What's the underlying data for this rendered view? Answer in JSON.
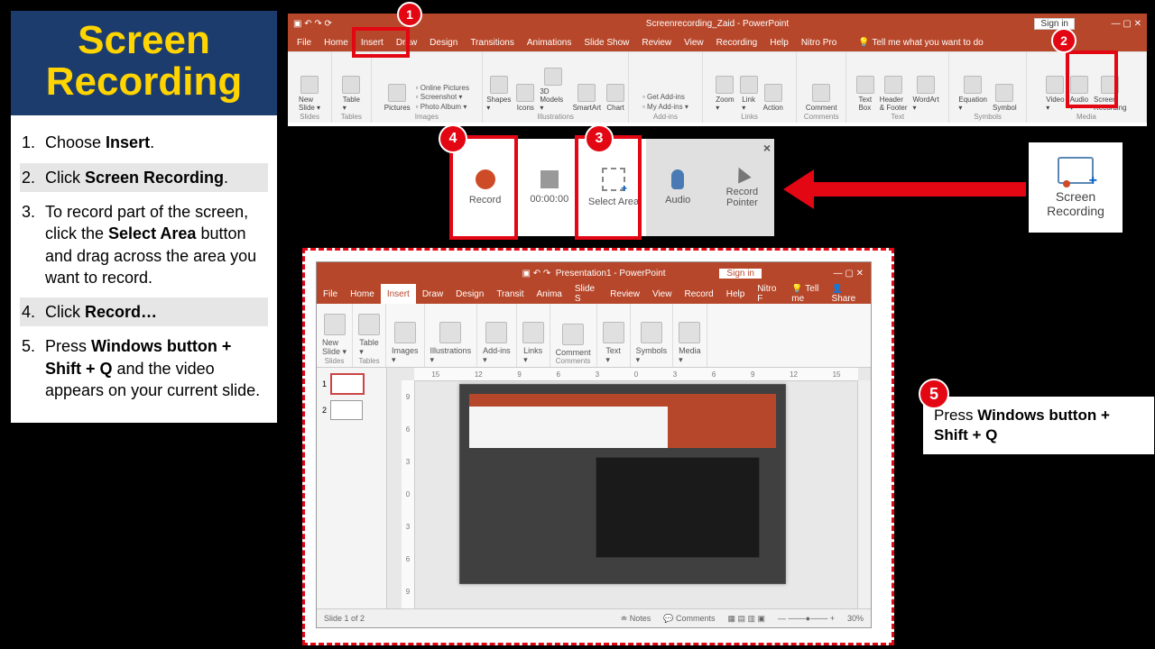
{
  "title_line1": "Screen",
  "title_line2": "Recording",
  "steps": [
    {
      "num": "1.",
      "pre": "Choose ",
      "bold": "Insert",
      "post": "."
    },
    {
      "num": "2.",
      "pre": "Click ",
      "bold": "Screen Recording",
      "post": ".",
      "active": true
    },
    {
      "num": "3.",
      "pre": "To record part of the screen, click the ",
      "bold": "Select Area",
      "post": " button and drag across the area you want to record."
    },
    {
      "num": "4.",
      "pre": "Click ",
      "bold": "Record…",
      "post": "",
      "active": true
    },
    {
      "num": "5.",
      "pre": "Press ",
      "bold": "Windows button + Shift + Q",
      "post": " and the video appears on your current slide."
    }
  ],
  "markers": {
    "m1": "1",
    "m2": "2",
    "m3": "3",
    "m4": "4",
    "m5": "5"
  },
  "ribbon": {
    "titlebar_doc": "Screenrecording_Zaid - PowerPoint",
    "signin": "Sign in",
    "tabs": [
      "File",
      "Home",
      "Insert",
      "Draw",
      "Design",
      "Transitions",
      "Animations",
      "Slide Show",
      "Review",
      "View",
      "Recording",
      "Help",
      "Nitro Pro"
    ],
    "tellme": "Tell me what you want to do",
    "groups": {
      "slides": {
        "label": "Slides",
        "items": [
          "New Slide ▾"
        ]
      },
      "tables": {
        "label": "Tables",
        "items": [
          "Table ▾"
        ]
      },
      "images": {
        "label": "Images",
        "items": [
          "Pictures"
        ],
        "mini": [
          "Online Pictures",
          "Screenshot ▾",
          "Photo Album ▾"
        ]
      },
      "illus": {
        "label": "Illustrations",
        "items": [
          "Shapes ▾",
          "Icons",
          "3D Models ▾",
          "SmartArt",
          "Chart"
        ]
      },
      "addins": {
        "label": "Add-ins",
        "mini": [
          "Get Add-ins",
          "My Add-ins ▾"
        ]
      },
      "links": {
        "label": "Links",
        "items": [
          "Zoom ▾",
          "Link ▾",
          "Action"
        ]
      },
      "comments": {
        "label": "Comments",
        "items": [
          "Comment"
        ]
      },
      "text": {
        "label": "Text",
        "items": [
          "Text Box",
          "Header & Footer",
          "WordArt ▾"
        ]
      },
      "symbols": {
        "label": "Symbols",
        "items": [
          "Equation ▾",
          "Symbol"
        ]
      },
      "media": {
        "label": "Media",
        "items": [
          "Video ▾",
          "Audio ▾",
          "Screen Recording"
        ]
      }
    }
  },
  "toolbar": {
    "record": "Record",
    "time": "00:00:00",
    "select": "Select Area",
    "audio": "Audio",
    "pointer": "Record Pointer",
    "close": "×"
  },
  "big_sr_button": {
    "line1": "Screen",
    "line2": "Recording"
  },
  "step5box": {
    "pre": "Press ",
    "bold": "Windows button + Shift + Q"
  },
  "mini_app": {
    "title": "Presentation1 - PowerPoint",
    "signin": "Sign in",
    "tabs": [
      "File",
      "Home",
      "Insert",
      "Draw",
      "Design",
      "Transit",
      "Anima",
      "Slide S",
      "Review",
      "View",
      "Record",
      "Help",
      "Nitro F"
    ],
    "tellme": "Tell me",
    "share": "Share",
    "groups": [
      {
        "name": "New Slide ▾",
        "label": "Slides"
      },
      {
        "name": "Table ▾",
        "label": "Tables"
      },
      {
        "name": "Images ▾",
        "label": ""
      },
      {
        "name": "Illustrations ▾",
        "label": ""
      },
      {
        "name": "Add-ins ▾",
        "label": ""
      },
      {
        "name": "Links ▾",
        "label": ""
      },
      {
        "name": "Comment",
        "label": "Comments"
      },
      {
        "name": "Text ▾",
        "label": ""
      },
      {
        "name": "Symbols ▾",
        "label": ""
      },
      {
        "name": "Media ▾",
        "label": ""
      }
    ],
    "ruler": [
      "15",
      "12",
      "9",
      "6",
      "3",
      "0",
      "3",
      "6",
      "9",
      "12",
      "15"
    ],
    "ruler_v": [
      "9",
      "6",
      "3",
      "0",
      "3",
      "6",
      "9"
    ],
    "thumbs": [
      "1",
      "2"
    ],
    "status": {
      "slide": "Slide 1 of 2",
      "notes": "Notes",
      "comments": "Comments",
      "zoom": "30%"
    }
  }
}
